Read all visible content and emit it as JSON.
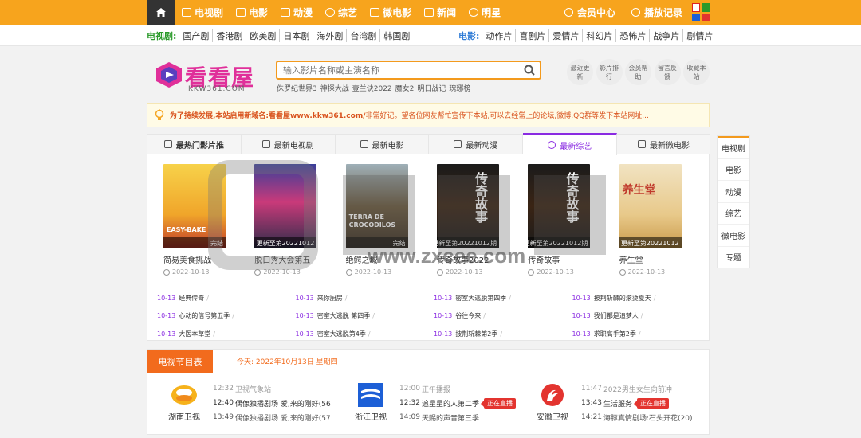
{
  "topnav": {
    "items": [
      "电视剧",
      "电影",
      "动漫",
      "综艺",
      "微电影",
      "新闻",
      "明星"
    ],
    "member": "会员中心",
    "history": "播放记录"
  },
  "subnav": {
    "tv_label": "电视剧:",
    "tv_links": [
      "国产剧",
      "香港剧",
      "欧美剧",
      "日本剧",
      "海外剧",
      "台湾剧",
      "韩国剧"
    ],
    "movie_label": "电影:",
    "movie_links": [
      "动作片",
      "喜剧片",
      "爱情片",
      "科幻片",
      "恐怖片",
      "战争片",
      "剧情片"
    ]
  },
  "logo": {
    "text": "看看屋",
    "sub": "KKW361.COM"
  },
  "search": {
    "placeholder": "输入影片名称或主演名称",
    "hot": [
      "侏罗纪世界3",
      "神探大战",
      "壹兰诀2022",
      "魔女2",
      "明日战记",
      "瑰琊榜"
    ]
  },
  "quick": [
    "最近更新",
    "影片排行",
    "会员帮助",
    "留言反馈",
    "收藏本站"
  ],
  "notice": {
    "t1": "为了持续发展,本站启用新域名:",
    "t2": "看看屋www.kkw361.com/",
    "t3": " 非常好记。望各位网友帮忙宣传下本站,可以去经常上的论坛,微博,QQ群等发下本站网址..."
  },
  "tabs": [
    "最热门影片推",
    "最新电视剧",
    "最新电影",
    "最新动漫",
    "最新综艺",
    "最新微电影"
  ],
  "cards": [
    {
      "title": "简易美食挑战",
      "date": "2022-10-13",
      "badge": "完结",
      "poster_text": "EASY-BAKE"
    },
    {
      "title": "脱口秀大会第五",
      "date": "2022-10-13",
      "badge": "更新至第20221012",
      "poster_text": ""
    },
    {
      "title": "绝鳄之域",
      "date": "2022-10-13",
      "badge": "完结",
      "poster_text": "TERRA DE CROCODILOS"
    },
    {
      "title": "传奇故事2022",
      "date": "2022-10-13",
      "badge": "更新至第20221012期",
      "poster_text": "传奇故事"
    },
    {
      "title": "传奇故事",
      "date": "2022-10-13",
      "badge": "更新至第20221012期",
      "poster_text": "传奇故事"
    },
    {
      "title": "养生堂",
      "date": "2022-10-13",
      "badge": "更新至第20221012",
      "poster_text": "养生堂"
    }
  ],
  "list": [
    [
      "10-13",
      "经典传奇"
    ],
    [
      "10-13",
      "来你厨房"
    ],
    [
      "10-13",
      "密室大逃脱第四季"
    ],
    [
      "10-13",
      "披荆斩棘的滚烫夏天"
    ],
    [
      "10-13",
      "心动的信号第五季"
    ],
    [
      "10-13",
      "密室大逃脱 第四季"
    ],
    [
      "10-13",
      "谷往今来"
    ],
    [
      "10-13",
      "我们都是追梦人"
    ],
    [
      "10-13",
      "大医本草堂"
    ],
    [
      "10-13",
      "密室大逃脱第4季"
    ],
    [
      "10-13",
      "披荆斩棘第2季"
    ],
    [
      "10-13",
      "求职高手第2季"
    ]
  ],
  "tv": {
    "heading": "电视节目表",
    "today": "今天: 2022年10月13日 星期四",
    "live": "正在直播",
    "channels": [
      {
        "name": "湖南卫视",
        "rows": [
          [
            "12:32",
            "卫视气象站"
          ],
          [
            "12:40",
            "偶像独播剧场 爱,来的刚好(56"
          ],
          [
            "13:49",
            "偶像独播剧场 爱,来的刚好(57"
          ]
        ],
        "now": 1
      },
      {
        "name": "浙江卫视",
        "rows": [
          [
            "12:00",
            "正午播报"
          ],
          [
            "12:32",
            "追星星的人第二季"
          ],
          [
            "14:09",
            "天赐的声音第三季"
          ]
        ],
        "now": 1
      },
      {
        "name": "安徽卫视",
        "rows": [
          [
            "11:47",
            "2022男生女生向前冲"
          ],
          [
            "13:43",
            "生活服务"
          ],
          [
            "14:21",
            "海豚真情剧场:石头开花(20)"
          ]
        ],
        "now": 1
      }
    ]
  },
  "sidenav": [
    "电视剧",
    "电影",
    "动漫",
    "综艺",
    "微电影",
    "专题"
  ],
  "watermark": "www.zxcee.com",
  "colors": {
    "brand_orange": "#f7a41d",
    "accent_purple": "#8a2be2",
    "live_red": "#e3342f"
  }
}
